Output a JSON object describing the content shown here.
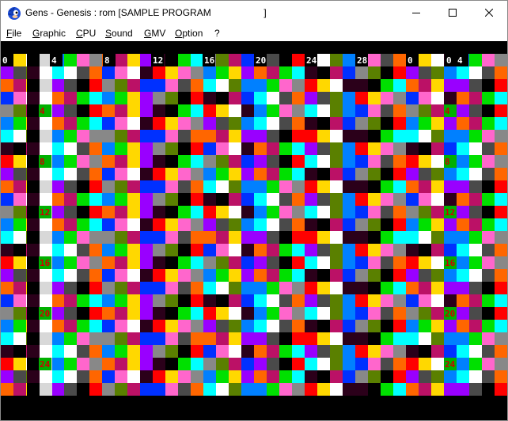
{
  "window": {
    "title": "Gens - Genesis : rom [SAMPLE PROGRAM                    ]",
    "app_icon": "gens-sonic-icon",
    "controls": [
      "minimize-icon",
      "maximize-icon",
      "close-icon"
    ]
  },
  "menu": {
    "items": [
      {
        "label": "File"
      },
      {
        "label": "Graphic"
      },
      {
        "label": "CPU"
      },
      {
        "label": "Sound"
      },
      {
        "label": "GMV"
      },
      {
        "label": "Option"
      },
      {
        "label": "?"
      }
    ]
  },
  "screen": {
    "palette": [
      "#ff0000",
      "#00e000",
      "#0030ff",
      "#ffd800",
      "#00ffff",
      "#ff66cc",
      "#9900ff",
      "#ffffff",
      "#888888",
      "#4a4a4a",
      "#2b001a",
      "#5a8000",
      "#ff6600",
      "#000000",
      "#0080ff",
      "#bb1166"
    ],
    "column_markers": [
      "0",
      "4",
      "8",
      "12",
      "16",
      "20",
      "24",
      "28",
      "0",
      "0",
      "4"
    ],
    "row_markers": [
      "4",
      "8",
      "12",
      "16",
      "20",
      "24"
    ],
    "row_markers_right": [
      "4",
      "8",
      "12",
      "16",
      "20",
      "24"
    ]
  }
}
